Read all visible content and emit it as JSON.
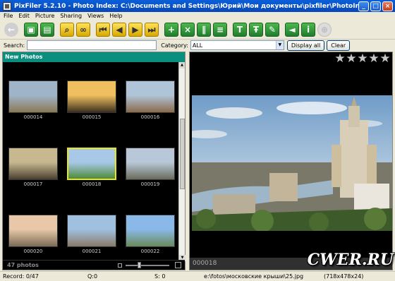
{
  "window": {
    "title": "PixFiler 5.2.10 - Photo Index: C:\\Documents and Settings\\Юрий\\Мои документы\\pixfiler\\PhotoIndex.pxf"
  },
  "menu": [
    "File",
    "Edit",
    "Picture",
    "Sharing",
    "Views",
    "Help"
  ],
  "toolbar": {
    "icons": [
      "back-icon",
      "photo-icon",
      "scanner-icon",
      "find-icon",
      "binoculars-icon",
      "first-icon",
      "prev-icon",
      "next-icon",
      "last-icon",
      "add-icon",
      "delete-icon",
      "clip-icon",
      "list-icon",
      "text-icon",
      "text-bold-icon",
      "edit-icon",
      "megaphone-icon",
      "info-icon",
      "web-icon"
    ]
  },
  "search": {
    "label": "Search:",
    "value": "",
    "category_label": "Category:",
    "category_value": "ALL",
    "display_all": "Display all",
    "clear": "Clear"
  },
  "left_panel": {
    "header": "New Photos",
    "photo_count": "47 photos",
    "zoom_level": 0.3,
    "thumbnails": [
      {
        "id": "000014",
        "colors": [
          "#9fb4c8",
          "#8a7a55"
        ]
      },
      {
        "id": "000015",
        "colors": [
          "#f0c060",
          "#3a3020"
        ]
      },
      {
        "id": "000016",
        "colors": [
          "#b0c4d8",
          "#8a6a4a"
        ]
      },
      {
        "id": "000017",
        "colors": [
          "#c8b890",
          "#4a4030"
        ]
      },
      {
        "id": "000018",
        "colors": [
          "#a8c8e8",
          "#4e8a3a"
        ],
        "selected": true
      },
      {
        "id": "000019",
        "colors": [
          "#b8c8d8",
          "#6a6a5a"
        ]
      },
      {
        "id": "000020",
        "colors": [
          "#e8c8a8",
          "#7a6a58"
        ]
      },
      {
        "id": "000021",
        "colors": [
          "#a0c0e0",
          "#8a7a68"
        ]
      },
      {
        "id": "000022",
        "colors": [
          "#8ab8e8",
          "#6a8a5a"
        ]
      }
    ]
  },
  "right_panel": {
    "rating": 5,
    "caption": "000018"
  },
  "status": {
    "record": "Record: 0/47",
    "q": "Q:0",
    "s": "S: 0",
    "path": "e:\\fotos\\московские крыши\\25.jpg",
    "dims": "(718x478x24)"
  },
  "watermark": "CWER.RU"
}
